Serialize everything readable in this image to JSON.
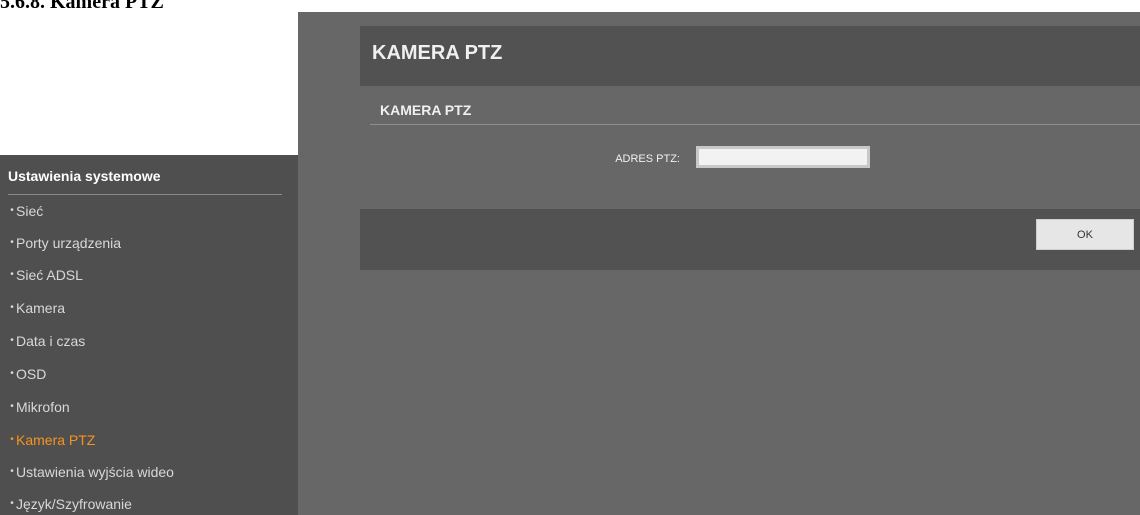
{
  "document": {
    "heading": "5.6.8. Kamera PTZ"
  },
  "sidebar": {
    "title": "Ustawienia systemowe",
    "items": [
      {
        "label": "Sieć",
        "active": false
      },
      {
        "label": "Porty urządzenia",
        "active": false
      },
      {
        "label": "Sieć ADSL",
        "active": false
      },
      {
        "label": "Kamera",
        "active": false
      },
      {
        "label": "Data i czas",
        "active": false
      },
      {
        "label": "OSD",
        "active": false
      },
      {
        "label": "Mikrofon",
        "active": false
      },
      {
        "label": "Kamera PTZ",
        "active": true
      },
      {
        "label": "Ustawienia wyjścia wideo",
        "active": false
      },
      {
        "label": "Język/Szyfrowanie",
        "active": false
      }
    ],
    "bullet": "•"
  },
  "main": {
    "page_title": "KAMERA PTZ",
    "section_title": "KAMERA PTZ",
    "field_label": "ADRES PTZ:",
    "field_value": "",
    "ok_label": "OK"
  },
  "colors": {
    "active": "#f7941d",
    "sidebar_bg": "#4f4f4f",
    "main_bg": "#676767",
    "panel_bg": "#525252"
  }
}
